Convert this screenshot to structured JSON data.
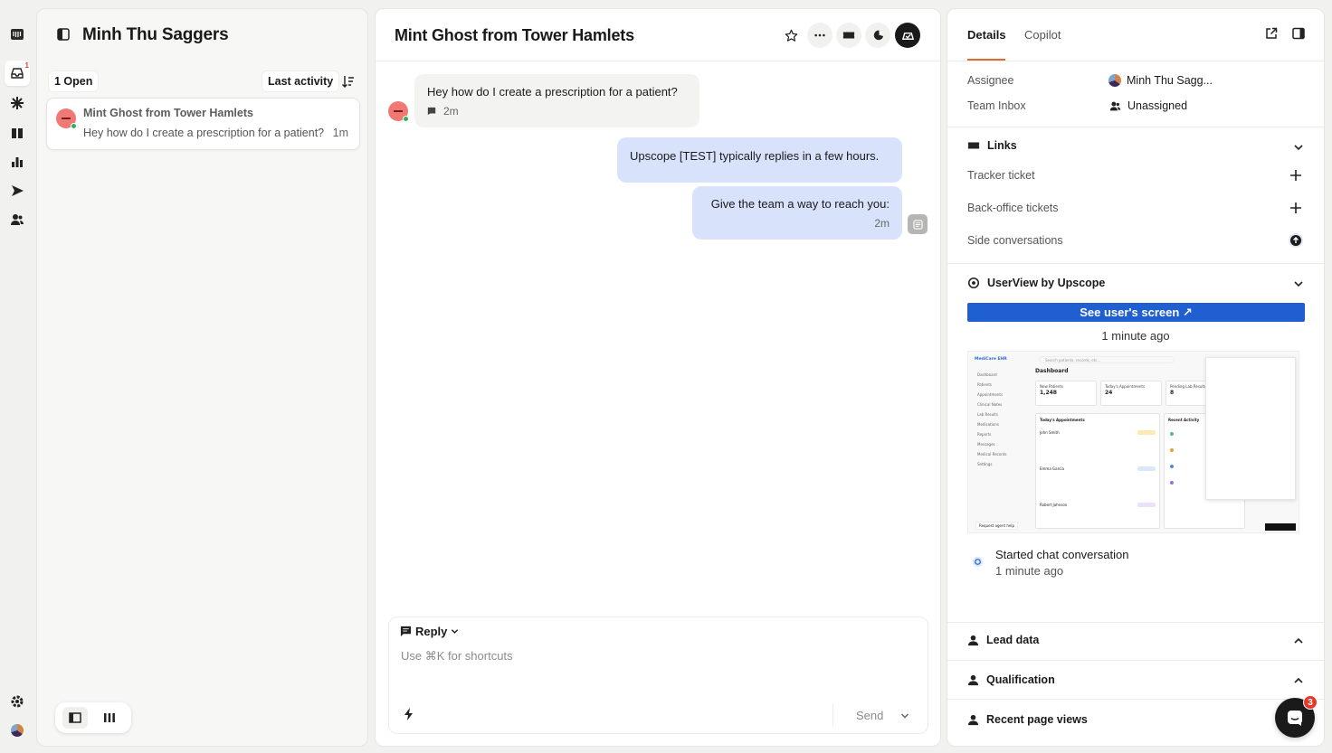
{
  "rail": {
    "inbox_badge": "1"
  },
  "inbox": {
    "title": "Minh Thu Saggers",
    "open_count": "1 Open",
    "sort_label": "Last activity",
    "conversations": [
      {
        "name": "Mint Ghost from Tower Hamlets",
        "preview": "Hey how do I create a prescription for a patient?",
        "time": "1m"
      }
    ]
  },
  "conversation": {
    "title": "Mint Ghost from Tower Hamlets",
    "messages": [
      {
        "text": "Hey how do I create a prescription for a patient?",
        "meta": "2m"
      },
      {
        "text": "Upscope [TEST] typically replies in a few hours."
      },
      {
        "text": "Give the team a way to reach you:",
        "meta": "2m"
      }
    ],
    "composer": {
      "mode": "Reply",
      "placeholder": "Use ⌘K for shortcuts",
      "send": "Send"
    }
  },
  "details": {
    "tabs": [
      "Details",
      "Copilot"
    ],
    "assignee_label": "Assignee",
    "assignee_value": "Minh Thu Sagg...",
    "team_label": "Team Inbox",
    "team_value": "Unassigned",
    "links_title": "Links",
    "links": [
      "Tracker ticket",
      "Back-office tickets",
      "Side conversations"
    ],
    "userview_title": "UserView by Upscope",
    "cta": "See user's screen ↗",
    "cta_time": "1 minute ago",
    "event_title": "Started chat conversation",
    "event_time": "1 minute ago",
    "sections": [
      "Lead data",
      "Qualification",
      "Recent page views"
    ]
  },
  "preview": {
    "brand": "MediCare EHR",
    "search": "Search patients, records, etc...",
    "heading": "Dashboard",
    "nav": [
      "Dashboard",
      "Patients",
      "Appointments",
      "Clinical Notes",
      "Lab Results",
      "Medications",
      "Reports",
      "Messages",
      "Medical Records",
      "Settings"
    ],
    "stats": [
      {
        "label": "New Patients",
        "value": "1,248"
      },
      {
        "label": "Today's Appointments",
        "value": "24"
      },
      {
        "label": "Pending Lab Results",
        "value": "8"
      }
    ],
    "appointments_title": "Today's Appointments",
    "activity_title": "Recent Activity",
    "appointments": [
      "John Smith",
      "Emma Garcia",
      "Robert Johnson"
    ],
    "help_text": "Request agent help"
  },
  "fab_badge": "3",
  "colors": {
    "accent": "#e06a2c",
    "cta": "#1f5fd0",
    "bubble_out": "#d8e3fb",
    "avatar": "#f07a73"
  }
}
